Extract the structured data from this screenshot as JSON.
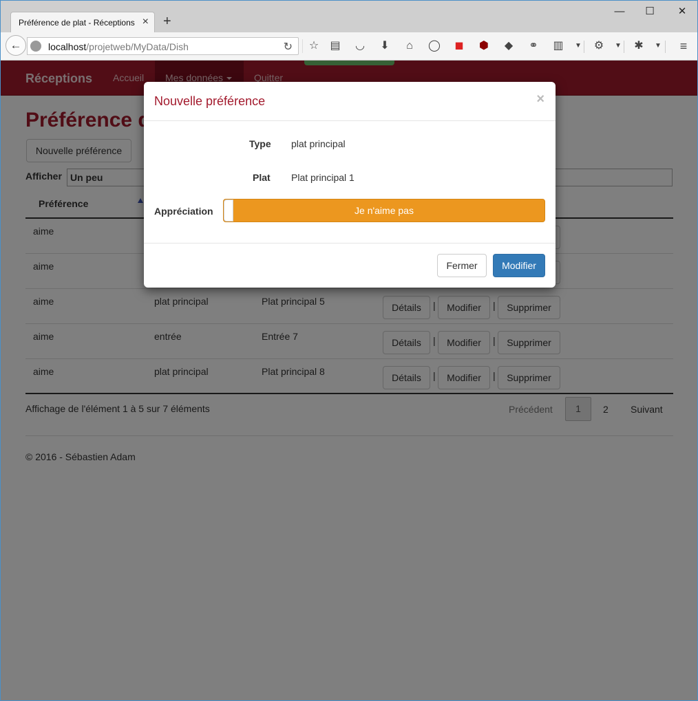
{
  "browser": {
    "tab_title": "Préférence de plat - Réceptions",
    "tab_close": "×",
    "new_tab": "+",
    "url_host": "localhost",
    "url_path": "/projetweb/MyData/Dish",
    "window_controls": {
      "minimize": "—",
      "maximize": "☐",
      "close": "✕"
    }
  },
  "site": {
    "brand": "Réceptions",
    "nav": {
      "home": "Accueil",
      "my_data": "Mes données",
      "quit": "Quitter"
    }
  },
  "page": {
    "title": "Préférence de plat",
    "new_button": "Nouvelle préférence",
    "filter_label": "Afficher",
    "filter_value": "Un peu",
    "column_preference": "Préférence",
    "rows": [
      {
        "preference": "aime",
        "type": "",
        "dish": ""
      },
      {
        "preference": "aime",
        "type": "",
        "dish": ""
      },
      {
        "preference": "aime",
        "type": "plat principal",
        "dish": "Plat principal 5"
      },
      {
        "preference": "aime",
        "type": "entrée",
        "dish": "Entrée 7"
      },
      {
        "preference": "aime",
        "type": "plat principal",
        "dish": "Plat principal 8"
      }
    ],
    "actions": {
      "details": "Détails",
      "edit": "Modifier",
      "delete": "Supprimer",
      "separator": "|"
    },
    "info": "Affichage de l'élément 1 à 5 sur 7 éléments",
    "pagination": {
      "previous": "Précédent",
      "current": "1",
      "next_page": "2",
      "next": "Suivant"
    },
    "footer": "© 2016 - Sébastien Adam"
  },
  "modal": {
    "title": "Nouvelle préférence",
    "close": "×",
    "type_label": "Type",
    "type_value": "plat principal",
    "dish_label": "Plat",
    "dish_value": "Plat principal 1",
    "rating_label": "Appréciation",
    "rating_value": "Je n'aime pas",
    "close_button": "Fermer",
    "submit_button": "Modifier"
  },
  "colors": {
    "brand": "#a31a2d",
    "slider": "#ec971f",
    "primary": "#337ab7"
  }
}
